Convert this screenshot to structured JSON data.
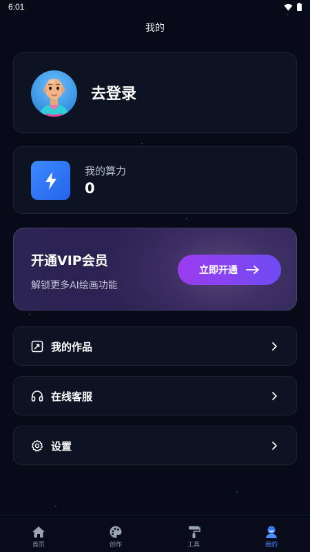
{
  "status_bar": {
    "time": "6:01"
  },
  "header": {
    "title": "我的"
  },
  "profile": {
    "login_text": "去登录"
  },
  "compute": {
    "label": "我的算力",
    "value": "0"
  },
  "vip": {
    "title": "开通VIP会员",
    "subtitle": "解锁更多AI绘画功能",
    "button_label": "立即开通",
    "colors": {
      "button_start": "#9a3cf0",
      "button_end": "#6f4cf2"
    }
  },
  "menu": [
    {
      "label": "我的作品",
      "icon": "edit-file-icon"
    },
    {
      "label": "在线客服",
      "icon": "headphones-icon"
    },
    {
      "label": "设置",
      "icon": "gear-icon"
    }
  ],
  "tabs": [
    {
      "label": "首页",
      "icon": "home-icon"
    },
    {
      "label": "创作",
      "icon": "palette-icon"
    },
    {
      "label": "工具",
      "icon": "paint-roller-icon"
    },
    {
      "label": "我的",
      "icon": "user-icon",
      "active": true
    }
  ],
  "colors": {
    "accent": "#4a8cff",
    "background": "#070b18",
    "card": "#0d1322"
  }
}
